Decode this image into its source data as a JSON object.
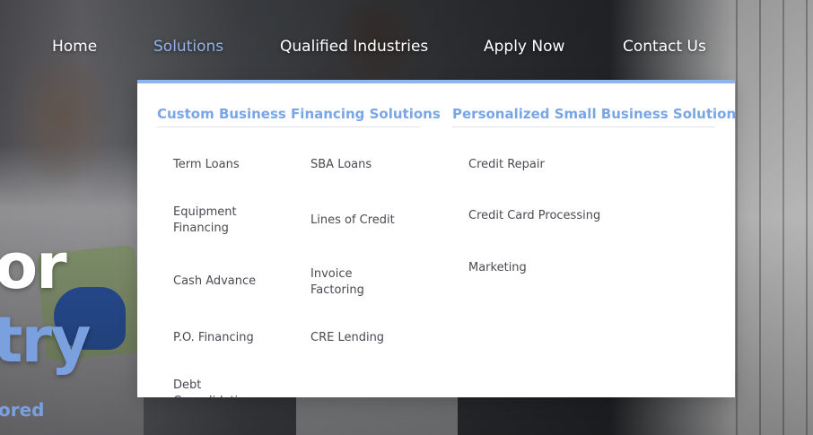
{
  "nav": {
    "items": [
      {
        "label": "Home",
        "active": false
      },
      {
        "label": "Solutions",
        "active": true
      },
      {
        "label": "Qualified Industries",
        "active": false
      },
      {
        "label": "Apply Now",
        "active": false
      },
      {
        "label": "Contact Us",
        "active": false
      }
    ]
  },
  "dropdown": {
    "columns": [
      {
        "heading": "Custom Business Financing Solutions",
        "links": [
          "Term Loans",
          "SBA Loans",
          "Equipment Financing",
          "Lines of Credit",
          "Cash Advance",
          "Invoice Factoring",
          "P.O. Financing",
          "CRE Lending",
          "Debt Consolidation"
        ]
      },
      {
        "heading": "Personalized Small Business Solutions",
        "links": [
          "Credit Repair",
          "Credit Card Processing",
          "Marketing"
        ]
      }
    ]
  },
  "hero": {
    "line1": "or",
    "line2": "try",
    "sub": "ored"
  },
  "colors": {
    "accent": "#8fb3ea",
    "heading": "#7aa6e6",
    "link_text": "#4a4a52",
    "nav_text": "#ffffff"
  }
}
